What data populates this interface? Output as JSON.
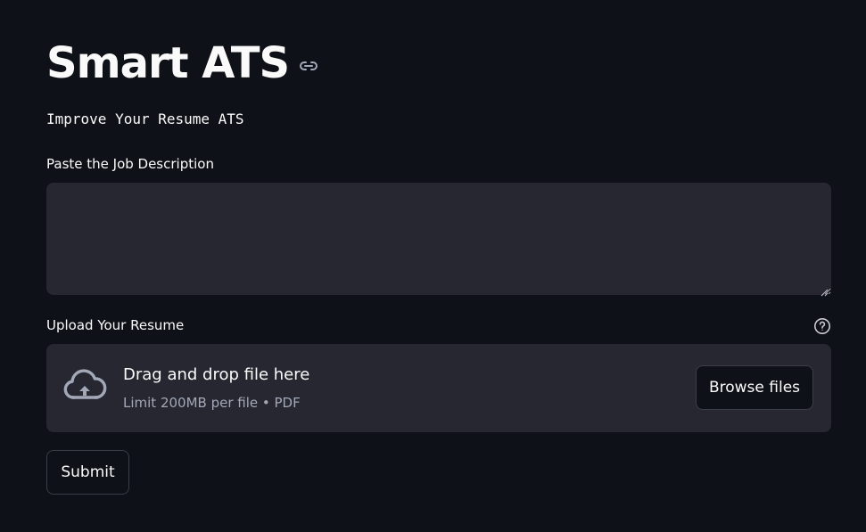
{
  "header": {
    "title": "Smart ATS",
    "anchor_icon": "link-icon",
    "subtitle": "Improve Your Resume ATS"
  },
  "job_description": {
    "label": "Paste the Job Description",
    "value": "",
    "placeholder": ""
  },
  "resume_upload": {
    "label": "Upload Your Resume",
    "help_icon": "question-circle-icon",
    "upload_icon": "cloud-upload-icon",
    "drop_text": "Drag and drop file here",
    "limit_text": "Limit 200MB per file • PDF",
    "browse_label": "Browse files"
  },
  "actions": {
    "submit_label": "Submit"
  },
  "colors": {
    "background": "#0e1117",
    "input_background": "#262730",
    "text": "#fafafa",
    "muted_text": "#a3a8b8",
    "border": "#3b3d47"
  }
}
